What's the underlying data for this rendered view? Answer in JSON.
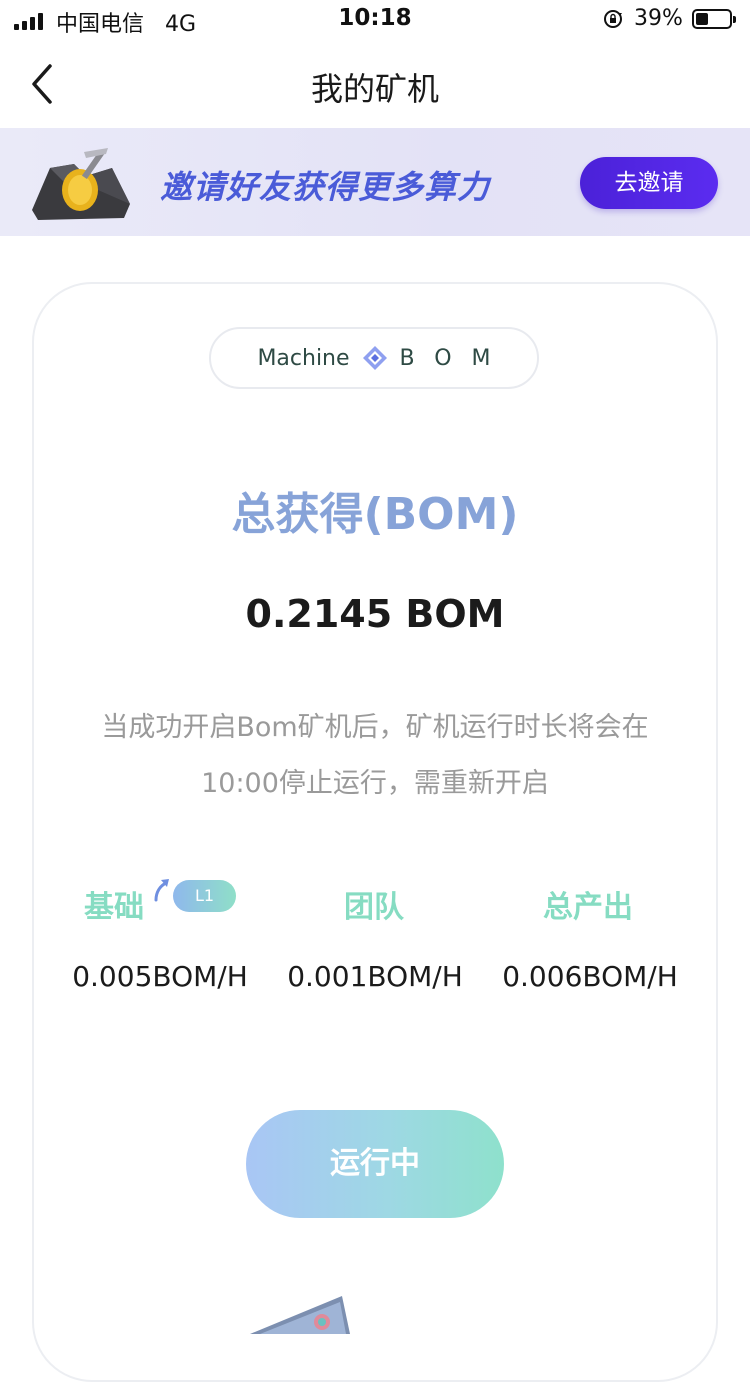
{
  "status_bar": {
    "carrier": "中国电信",
    "network": "4G",
    "time": "10:18",
    "battery": "39%"
  },
  "nav": {
    "title": "我的矿机",
    "back_icon": "chevron-left-icon"
  },
  "banner": {
    "text": "邀请好友获得更多算力",
    "button_label": "去邀请"
  },
  "machine_chip": {
    "label": "Machine",
    "token": "BOM",
    "icon": "bom-diamond-icon"
  },
  "summary": {
    "title": "总获得(BOM)",
    "value": "0.2145 BOM",
    "notice_line1": "当成功开启Bom矿机后，矿机运行时长将会在",
    "notice_line2": "10:00停止运行，需重新开启"
  },
  "stats": {
    "base": {
      "label": "基础",
      "level": "L1",
      "value": "0.005BOM/H"
    },
    "team": {
      "label": "团队",
      "value": "0.001BOM/H"
    },
    "total": {
      "label": "总产出",
      "value": "0.006BOM/H"
    }
  },
  "action": {
    "label": "运行中"
  },
  "colors": {
    "accent_text": "#87a3d8",
    "stat_label": "#86dcc2",
    "invite_button": "#4b21d8",
    "banner_text": "#4a5bd8"
  }
}
